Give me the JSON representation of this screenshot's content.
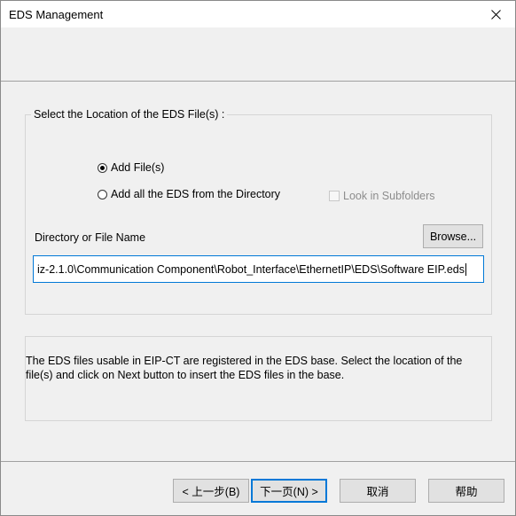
{
  "window": {
    "title": "EDS Management"
  },
  "location_group": {
    "label": "Select the Location of the EDS File(s) :",
    "radio_add_files": "Add File(s)",
    "radio_add_directory": "Add all the EDS from the Directory",
    "look_in_subfolders": "Look in Subfolders"
  },
  "file_field": {
    "label": "Directory or File Name",
    "browse_label": "Browse...",
    "value": "iz-2.1.0\\Communication Component\\Robot_Interface\\EthernetIP\\EDS\\Software EIP.eds"
  },
  "description": "The EDS files usable in EIP-CT are registered in the EDS base. Select the location of the file(s) and click on Next button to insert the EDS files in the base.",
  "footer": {
    "back_label": "< 上一步(B)",
    "next_label": "下一页(N) >",
    "cancel_label": "取消",
    "help_label": "帮助"
  }
}
